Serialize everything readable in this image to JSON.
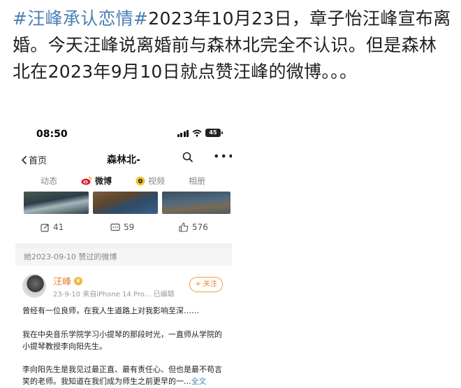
{
  "post": {
    "hashtag": "#汪峰承认恋情#",
    "text": "2023年10月23日，章子怡汪峰宣布离婚。今天汪峰说离婚前与森林北完全不认识。但是森林北在2023年9月10日就点赞汪峰的微博。。。"
  },
  "phone": {
    "status_time": "08:50",
    "battery_level": "45",
    "nav": {
      "back_label": "首页",
      "title": "森林北-"
    },
    "tabs": [
      {
        "label": "动态",
        "icon": ""
      },
      {
        "label": "微博",
        "icon": "weibo-icon"
      },
      {
        "label": "视频",
        "icon": "video-icon"
      },
      {
        "label": "相册",
        "icon": ""
      }
    ],
    "actions": {
      "repost_count": "41",
      "comment_count": "59",
      "like_count": "576"
    },
    "liked_header": "她2023-09-10 赞过的微博",
    "weibo": {
      "user_name": "汪峰",
      "meta": "23-9-10  来自iPhone 14 Pro...  已编辑",
      "follow_label": "+ 关注",
      "paragraphs": [
        "曾经有一位良师，在我人生道路上对我影响至深……",
        "我在中央音乐学院学习小提琴的那段时光，一直师从学院的小提琴教授李向阳先生。",
        "李向阳先生是我见过最正直、最有责任心、但也是最不苟言笑的老师。我知道在我们成为师生之前更早的一..."
      ],
      "full_text_link": "全文"
    },
    "colors": {
      "hashtag": "#4a7fb5",
      "username": "#e07b2b",
      "follow": "#e8852a"
    }
  }
}
